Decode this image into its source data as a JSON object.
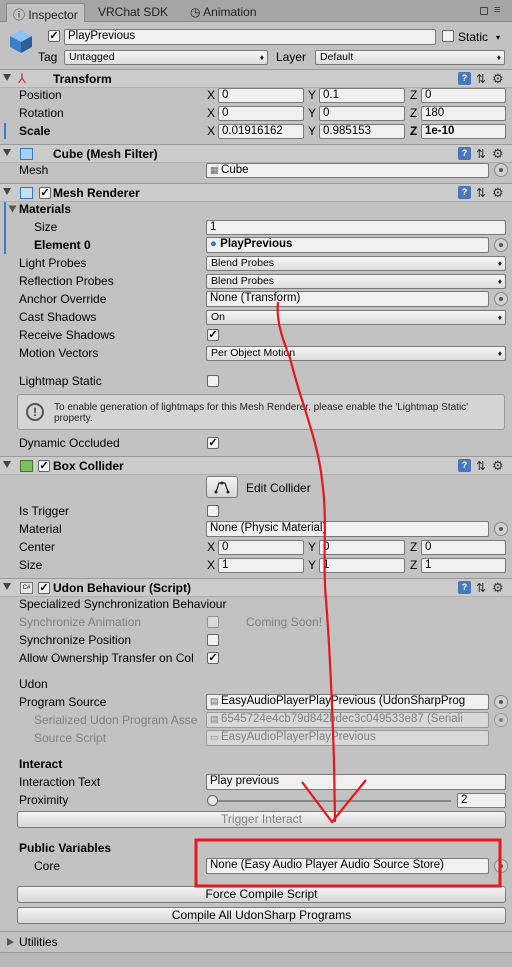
{
  "tabs": [
    {
      "label": "Inspector"
    },
    {
      "label": "VRChat SDK"
    },
    {
      "label": "Animation"
    }
  ],
  "header": {
    "name": "PlayPrevious",
    "static_label": "Static",
    "tag_label": "Tag",
    "tag_value": "Untagged",
    "layer_label": "Layer",
    "layer_value": "Default"
  },
  "transform": {
    "title": "Transform",
    "position_label": "Position",
    "rotation_label": "Rotation",
    "scale_label": "Scale",
    "position": {
      "x": "0",
      "y": "0.1",
      "z": "0"
    },
    "rotation": {
      "x": "0",
      "y": "0",
      "z": "180"
    },
    "scale": {
      "x": "0.01916162",
      "y": "0.985153",
      "z": "1e-10"
    }
  },
  "axes": {
    "x": "X",
    "y": "Y",
    "z": "Z"
  },
  "mesh_filter": {
    "title": "Cube (Mesh Filter)",
    "mesh_label": "Mesh",
    "mesh_value": "Cube"
  },
  "mesh_renderer": {
    "title": "Mesh Renderer",
    "materials_label": "Materials",
    "size_label": "Size",
    "size_value": "1",
    "element0_label": "Element 0",
    "element0_value": "PlayPrevious",
    "light_probes_label": "Light Probes",
    "light_probes_value": "Blend Probes",
    "reflection_probes_label": "Reflection Probes",
    "reflection_probes_value": "Blend Probes",
    "anchor_label": "Anchor Override",
    "anchor_value": "None (Transform)",
    "cast_label": "Cast Shadows",
    "cast_value": "On",
    "receive_label": "Receive Shadows",
    "motion_label": "Motion Vectors",
    "motion_value": "Per Object Motion",
    "lightmap_label": "Lightmap Static",
    "info_text": "To enable generation of lightmaps for this Mesh Renderer, please enable the 'Lightmap Static' property.",
    "dynamic_label": "Dynamic Occluded"
  },
  "box_collider": {
    "title": "Box Collider",
    "edit_label": "Edit Collider",
    "trigger_label": "Is Trigger",
    "material_label": "Material",
    "material_value": "None (Physic Material)",
    "center_label": "Center",
    "center": {
      "x": "0",
      "y": "0",
      "z": "0"
    },
    "size_label": "Size",
    "size": {
      "x": "1",
      "y": "1",
      "z": "1"
    }
  },
  "udon": {
    "title": "Udon Behaviour (Script)",
    "specialized": "Specialized Synchronization Behaviour",
    "sync_anim_label": "Synchronize Animation",
    "coming_soon": "Coming Soon!",
    "sync_pos_label": "Synchronize Position",
    "ownership_label": "Allow Ownership Transfer on Col",
    "udon_label": "Udon",
    "program_source_label": "Program Source",
    "program_source_value": "EasyAudioPlayerPlayPrevious (UdonSharpProg",
    "serialized_label": "Serialized Udon Program Asse",
    "serialized_value": "6545724e4cb79d842bdec3c049533e87 (Seriali",
    "source_script_label": "Source Script",
    "source_script_value": "EasyAudioPlayerPlayPrevious",
    "interact_label": "Interact",
    "interaction_text_label": "Interaction Text",
    "interaction_text_value": "Play previous",
    "proximity_label": "Proximity",
    "proximity_value": "2",
    "proximity_fraction": 0.0,
    "trigger_button": "Trigger Interact",
    "public_vars_label": "Public Variables",
    "core_label": "Core",
    "core_value": "None (Easy Audio Player Audio Source Store)",
    "force_compile": "Force Compile Script",
    "compile_all": "Compile All UdonSharp Programs"
  },
  "utilities": {
    "label": "Utilities"
  },
  "icons": {
    "checkmark": "✓",
    "dropdown": "♦"
  },
  "colors": {
    "annotation": "#e8161e"
  }
}
